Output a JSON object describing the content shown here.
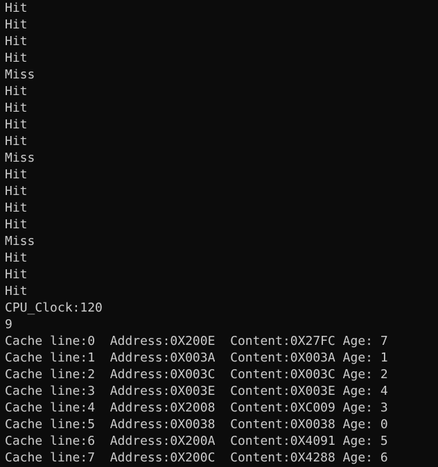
{
  "terminal": {
    "lines": [
      "Hit",
      "Hit",
      "Hit",
      "Hit",
      "Miss",
      "Hit",
      "Hit",
      "Hit",
      "Hit",
      "Miss",
      "Hit",
      "Hit",
      "Hit",
      "Hit",
      "Miss",
      "Hit",
      "Hit",
      "Hit",
      "CPU_Clock:120",
      "9"
    ],
    "cache_rows": [
      "Cache line:0  Address:0X200E  Content:0X27FC Age: 7",
      "Cache line:1  Address:0X003A  Content:0X003A Age: 1",
      "Cache line:2  Address:0X003C  Content:0X003C Age: 2",
      "Cache line:3  Address:0X003E  Content:0X003E Age: 4",
      "Cache line:4  Address:0X2008  Content:0XC009 Age: 3",
      "Cache line:5  Address:0X0038  Content:0X0038 Age: 0",
      "Cache line:6  Address:0X200A  Content:0X4091 Age: 5",
      "Cache line:7  Address:0X200C  Content:0X4288 Age: 6"
    ]
  },
  "colors": {
    "background": "#0c0c0c",
    "foreground": "#cccccc"
  }
}
